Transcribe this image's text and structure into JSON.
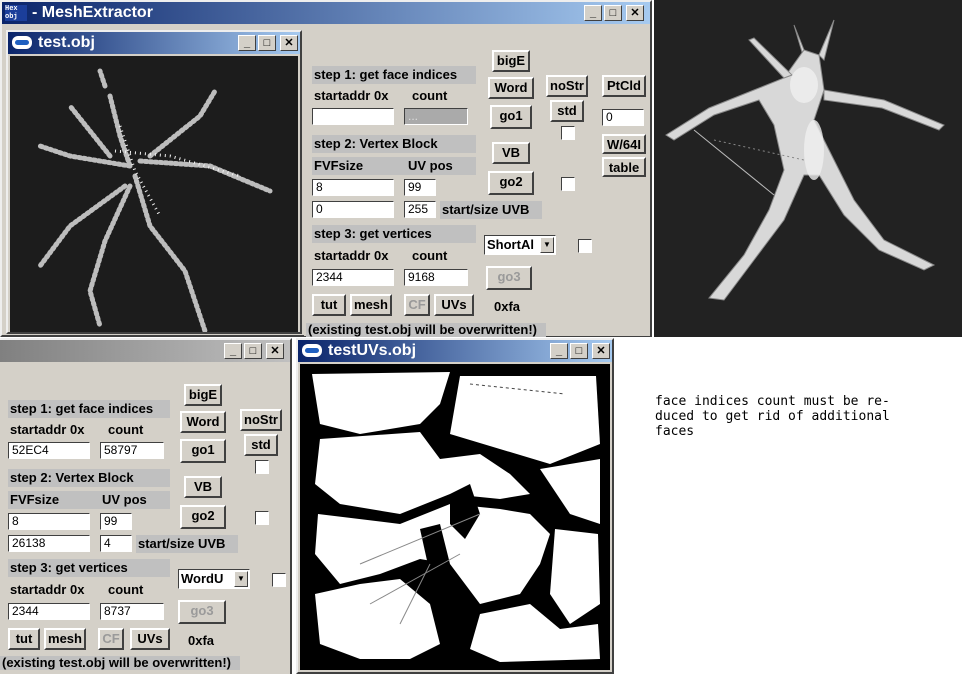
{
  "main_window": {
    "title": "MeshExtractor",
    "icon_text": [
      "Hex",
      "obj"
    ]
  },
  "test_obj_window": {
    "title": "test.obj"
  },
  "test_uvs_window": {
    "title": "testUVs.obj"
  },
  "top_panel": {
    "step1": "step 1: get face indices",
    "startaddr": "startaddr 0x",
    "count": "count",
    "face_start": "",
    "face_count": "...",
    "step2": "step 2: Vertex Block",
    "fvf_label": "FVFsize",
    "uvpos_label": "UV pos",
    "fvf_value": "8",
    "uvpos_value": "99",
    "uvb_start": "0",
    "uvb_size": "255",
    "uvb_label": "start/size UVB",
    "step3": "step 3: get vertices",
    "startaddr2": "startaddr 0x",
    "count2": "count",
    "vert_start": "2344",
    "vert_count": "9168",
    "bigE": "bigE",
    "word": "Word",
    "go1": "go1",
    "vb": "VB",
    "go2": "go2",
    "go3": "go3",
    "noStr": "noStr",
    "std": "std",
    "ptcld": "PtCld",
    "ptcld_value": "0",
    "w64": "W/64I",
    "table": "table",
    "combo": "ShortAl",
    "tut": "tut",
    "mesh": "mesh",
    "cf": "CF",
    "uvs": "UVs",
    "hex": "0xfa",
    "status": "(existing test.obj will be overwritten!)"
  },
  "bottom_panel": {
    "step1": "step 1: get face indices",
    "startaddr": "startaddr 0x",
    "count": "count",
    "face_start": "52EC4",
    "face_count": "58797",
    "step2": "step 2: Vertex Block",
    "fvf_label": "FVFsize",
    "uvpos_label": "UV pos",
    "fvf_value": "8",
    "uvpos_value": "99",
    "uvb_start": "26138",
    "uvb_size": "4",
    "uvb_label": "start/size UVB",
    "step3": "step 3: get vertices",
    "startaddr2": "startaddr 0x",
    "count2": "count",
    "vert_start": "2344",
    "vert_count": "8737",
    "bigE": "bigE",
    "word": "Word",
    "go1": "go1",
    "vb": "VB",
    "go2": "go2",
    "go3": "go3",
    "noStr": "noStr",
    "std": "std",
    "combo": "WordU",
    "tut": "tut",
    "mesh": "mesh",
    "cf": "CF",
    "uvs": "UVs",
    "hex": "0xfa",
    "status": "(existing test.obj will be overwritten!)"
  },
  "note": "face indices count must be re-\nduced to get rid of additional\nfaces",
  "colors": {
    "title_active": "#0a246a",
    "window_bg": "#d4d0c8",
    "viewport_bg": "#1c1c1c"
  }
}
